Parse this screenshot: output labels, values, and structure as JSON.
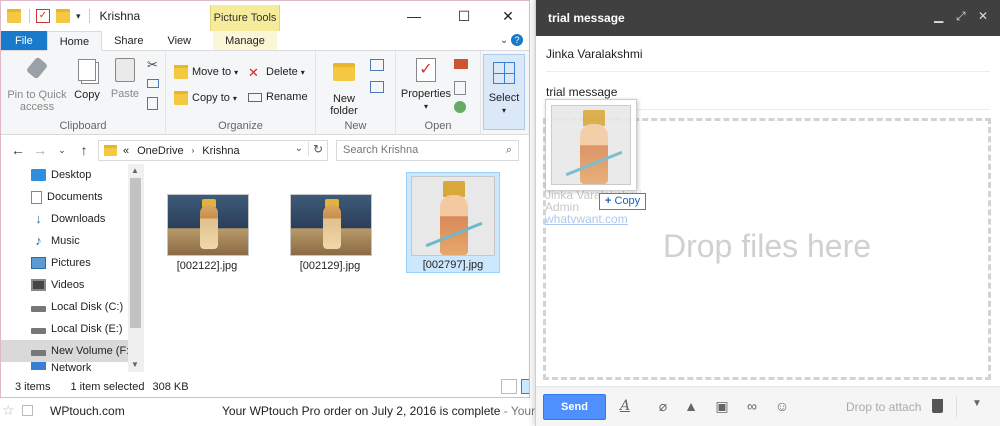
{
  "explorer": {
    "window_title": "Krishna",
    "picture_tools": "Picture Tools",
    "tabs": [
      "File",
      "Home",
      "Share",
      "View",
      "Manage"
    ],
    "ribbon": {
      "clipboard": {
        "pin_label": "Pin to Quick access",
        "copy_label": "Copy",
        "paste_label": "Paste",
        "group_label": "Clipboard"
      },
      "organize": {
        "move_to": "Move to",
        "copy_to": "Copy to",
        "delete": "Delete",
        "rename": "Rename",
        "group_label": "Organize"
      },
      "new": {
        "new_folder": "New folder",
        "group_label": "New"
      },
      "open": {
        "properties": "Properties",
        "group_label": "Open"
      },
      "select": {
        "select_label": "Select"
      }
    },
    "address": {
      "prefix": "«",
      "crumbs": [
        "OneDrive",
        "Krishna"
      ]
    },
    "search_placeholder": "Search Krishna",
    "nav_items": [
      {
        "label": "Desktop",
        "icon": "desktop-icon"
      },
      {
        "label": "Documents",
        "icon": "documents-icon"
      },
      {
        "label": "Downloads",
        "icon": "downloads-icon"
      },
      {
        "label": "Music",
        "icon": "music-icon"
      },
      {
        "label": "Pictures",
        "icon": "pictures-icon"
      },
      {
        "label": "Videos",
        "icon": "videos-icon"
      },
      {
        "label": "Local Disk (C:)",
        "icon": "disk-icon"
      },
      {
        "label": "Local Disk (E:)",
        "icon": "disk-icon"
      },
      {
        "label": "New Volume (F:)",
        "icon": "disk-icon"
      },
      {
        "label": "Network",
        "icon": "network-icon"
      }
    ],
    "files": [
      {
        "name": "[002122].jpg",
        "selected": false
      },
      {
        "name": "[002129].jpg",
        "selected": false
      },
      {
        "name": "[002797].jpg",
        "selected": true
      }
    ],
    "status": {
      "items": "3 items",
      "selected": "1 item selected",
      "size": "308 KB"
    }
  },
  "compose": {
    "title": "trial message",
    "to": "Jinka Varalakshmi",
    "subject": "trial message",
    "drop_text": "Drop files here",
    "signature": [
      "Jinka Varalakshmi",
      "Admin",
      "whatvwant.com"
    ],
    "copy_tip": "Copy",
    "send_label": "Send",
    "drop_hint": "Drop to attach",
    "accent": "#4d90fe"
  },
  "background_row": {
    "sender": "WPtouch.com",
    "subject": "Your WPtouch Pro order on July 2, 2016 is complete",
    "snippet": " - Your W"
  }
}
